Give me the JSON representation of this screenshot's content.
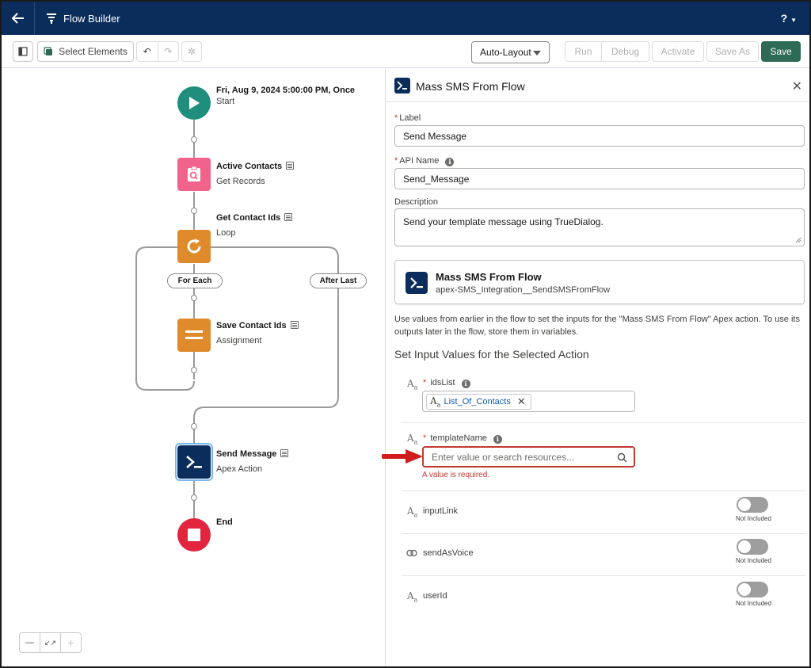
{
  "topbar": {
    "app_title": "Flow Builder",
    "help_label": "?"
  },
  "toolbar": {
    "select_elements": "Select Elements",
    "layout_mode": "Auto-Layout",
    "run": "Run",
    "debug": "Debug",
    "activate": "Activate",
    "save_as": "Save As",
    "save": "Save"
  },
  "canvas": {
    "start": {
      "title": "Fri, Aug 9, 2024 5:00:00 PM, Once",
      "sub": "Start"
    },
    "get_records": {
      "title": "Active Contacts",
      "sub": "Get Records"
    },
    "loop": {
      "title": "Get Contact Ids",
      "sub": "Loop"
    },
    "for_each": "For Each",
    "after_last": "After Last",
    "assignment": {
      "title": "Save Contact Ids",
      "sub": "Assignment"
    },
    "apex": {
      "title": "Send Message",
      "sub": "Apex Action"
    },
    "end": {
      "title": "End"
    },
    "zoom": {
      "out": "—",
      "fit": "↙↗",
      "in": "+"
    }
  },
  "panel": {
    "title": "Mass SMS From Flow",
    "label_field": {
      "label": "Label",
      "value": "Send Message"
    },
    "api_field": {
      "label": "API Name",
      "value": "Send_Message"
    },
    "description_field": {
      "label": "Description",
      "value": "Send your template message using TrueDialog."
    },
    "action_card": {
      "title": "Mass SMS From Flow",
      "sub": "apex-SMS_Integration__SendSMSFromFlow"
    },
    "help_text": "Use values from earlier in the flow to set the inputs for the \"Mass SMS From Flow\" Apex action. To use its outputs later in the flow, store them in variables.",
    "section_heading": "Set Input Values for the Selected Action",
    "params": {
      "ids_list": {
        "name": "idsList",
        "chip": "List_Of_Contacts"
      },
      "template_name": {
        "name": "templateName",
        "placeholder": "Enter value or search resources...",
        "error": "A value is required."
      },
      "input_link": {
        "name": "inputLink",
        "toggle": "Not Included"
      },
      "send_as_voice": {
        "name": "sendAsVoice",
        "toggle": "Not Included"
      },
      "user_id": {
        "name": "userId",
        "toggle": "Not Included"
      }
    }
  },
  "colors": {
    "header_bg": "#0b2d5c",
    "start": "#1f8e7c",
    "get_records": "#f0648b",
    "loop": "#e08b2b",
    "assignment": "#e08b2b",
    "apex": "#0b2d5c",
    "end": "#e2243f",
    "error": "#c23934",
    "save": "#2e6b57",
    "arrow": "#d01c1c"
  }
}
